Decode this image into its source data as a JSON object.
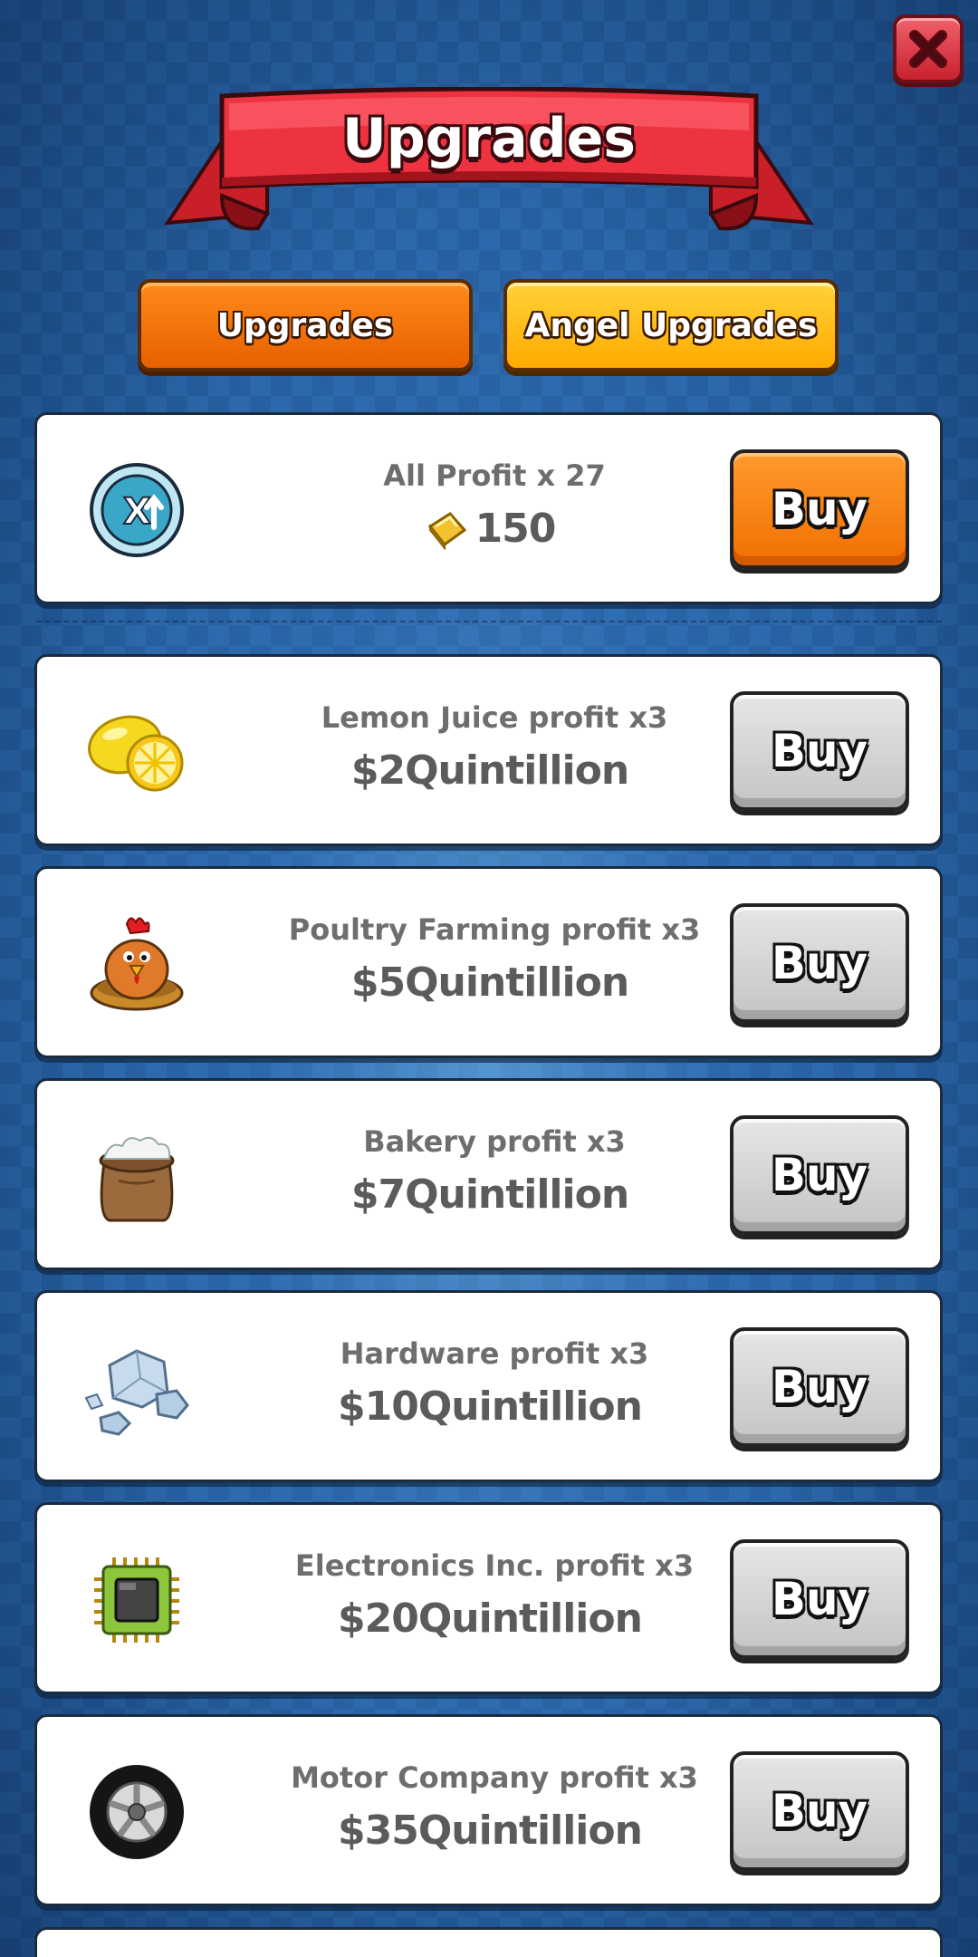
{
  "header": {
    "title": "Upgrades",
    "close_icon": "close-icon"
  },
  "tabs": [
    {
      "label": "Upgrades",
      "color": "#f07000"
    },
    {
      "label": "Angel Upgrades",
      "color": "#ffbe1a"
    }
  ],
  "featured": {
    "name": "All Profit x 27",
    "cost": "150",
    "cost_icon": "gold-bar-icon",
    "icon": "multiplier-badge-icon",
    "buy_label": "Buy"
  },
  "upgrades": [
    {
      "name": "Lemon Juice profit x3",
      "cost": "$2Quintillion",
      "icon": "lemon-icon",
      "buy_label": "Buy"
    },
    {
      "name": "Poultry Farming profit x3",
      "cost": "$5Quintillion",
      "icon": "chicken-icon",
      "buy_label": "Buy"
    },
    {
      "name": "Bakery profit x3",
      "cost": "$7Quintillion",
      "icon": "flour-sack-icon",
      "buy_label": "Buy"
    },
    {
      "name": "Hardware profit x3",
      "cost": "$10Quintillion",
      "icon": "ore-rocks-icon",
      "buy_label": "Buy"
    },
    {
      "name": "Electronics Inc. profit x3",
      "cost": "$20Quintillion",
      "icon": "microchip-icon",
      "buy_label": "Buy"
    },
    {
      "name": "Motor Company profit x3",
      "cost": "$35Quintillion",
      "icon": "tire-icon",
      "buy_label": "Buy"
    }
  ]
}
